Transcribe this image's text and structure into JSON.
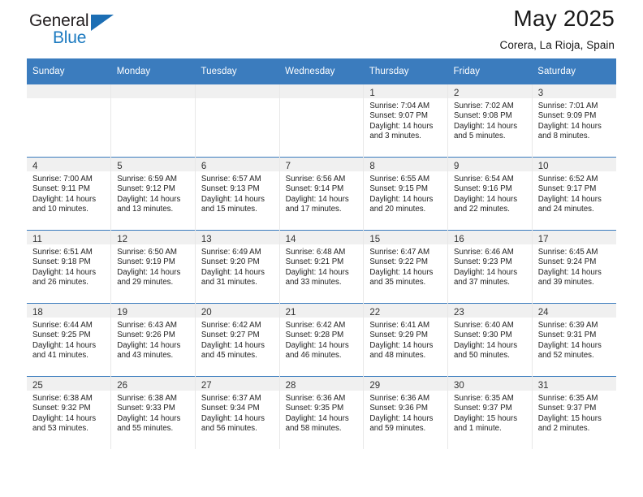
{
  "brand": {
    "name_top": "General",
    "name_bottom": "Blue",
    "accent_color": "#1c6eb4"
  },
  "header": {
    "title": "May 2025",
    "location": "Corera, La Rioja, Spain",
    "header_bg": "#3b7cbe",
    "daynum_band_bg": "#f0f0f0"
  },
  "weekday_headers": [
    "Sunday",
    "Monday",
    "Tuesday",
    "Wednesday",
    "Thursday",
    "Friday",
    "Saturday"
  ],
  "weeks": [
    [
      {
        "day": "",
        "sunrise": "",
        "sunset": "",
        "daylight_line1": "",
        "daylight_line2": ""
      },
      {
        "day": "",
        "sunrise": "",
        "sunset": "",
        "daylight_line1": "",
        "daylight_line2": ""
      },
      {
        "day": "",
        "sunrise": "",
        "sunset": "",
        "daylight_line1": "",
        "daylight_line2": ""
      },
      {
        "day": "",
        "sunrise": "",
        "sunset": "",
        "daylight_line1": "",
        "daylight_line2": ""
      },
      {
        "day": "1",
        "sunrise": "Sunrise: 7:04 AM",
        "sunset": "Sunset: 9:07 PM",
        "daylight_line1": "Daylight: 14 hours",
        "daylight_line2": "and 3 minutes."
      },
      {
        "day": "2",
        "sunrise": "Sunrise: 7:02 AM",
        "sunset": "Sunset: 9:08 PM",
        "daylight_line1": "Daylight: 14 hours",
        "daylight_line2": "and 5 minutes."
      },
      {
        "day": "3",
        "sunrise": "Sunrise: 7:01 AM",
        "sunset": "Sunset: 9:09 PM",
        "daylight_line1": "Daylight: 14 hours",
        "daylight_line2": "and 8 minutes."
      }
    ],
    [
      {
        "day": "4",
        "sunrise": "Sunrise: 7:00 AM",
        "sunset": "Sunset: 9:11 PM",
        "daylight_line1": "Daylight: 14 hours",
        "daylight_line2": "and 10 minutes."
      },
      {
        "day": "5",
        "sunrise": "Sunrise: 6:59 AM",
        "sunset": "Sunset: 9:12 PM",
        "daylight_line1": "Daylight: 14 hours",
        "daylight_line2": "and 13 minutes."
      },
      {
        "day": "6",
        "sunrise": "Sunrise: 6:57 AM",
        "sunset": "Sunset: 9:13 PM",
        "daylight_line1": "Daylight: 14 hours",
        "daylight_line2": "and 15 minutes."
      },
      {
        "day": "7",
        "sunrise": "Sunrise: 6:56 AM",
        "sunset": "Sunset: 9:14 PM",
        "daylight_line1": "Daylight: 14 hours",
        "daylight_line2": "and 17 minutes."
      },
      {
        "day": "8",
        "sunrise": "Sunrise: 6:55 AM",
        "sunset": "Sunset: 9:15 PM",
        "daylight_line1": "Daylight: 14 hours",
        "daylight_line2": "and 20 minutes."
      },
      {
        "day": "9",
        "sunrise": "Sunrise: 6:54 AM",
        "sunset": "Sunset: 9:16 PM",
        "daylight_line1": "Daylight: 14 hours",
        "daylight_line2": "and 22 minutes."
      },
      {
        "day": "10",
        "sunrise": "Sunrise: 6:52 AM",
        "sunset": "Sunset: 9:17 PM",
        "daylight_line1": "Daylight: 14 hours",
        "daylight_line2": "and 24 minutes."
      }
    ],
    [
      {
        "day": "11",
        "sunrise": "Sunrise: 6:51 AM",
        "sunset": "Sunset: 9:18 PM",
        "daylight_line1": "Daylight: 14 hours",
        "daylight_line2": "and 26 minutes."
      },
      {
        "day": "12",
        "sunrise": "Sunrise: 6:50 AM",
        "sunset": "Sunset: 9:19 PM",
        "daylight_line1": "Daylight: 14 hours",
        "daylight_line2": "and 29 minutes."
      },
      {
        "day": "13",
        "sunrise": "Sunrise: 6:49 AM",
        "sunset": "Sunset: 9:20 PM",
        "daylight_line1": "Daylight: 14 hours",
        "daylight_line2": "and 31 minutes."
      },
      {
        "day": "14",
        "sunrise": "Sunrise: 6:48 AM",
        "sunset": "Sunset: 9:21 PM",
        "daylight_line1": "Daylight: 14 hours",
        "daylight_line2": "and 33 minutes."
      },
      {
        "day": "15",
        "sunrise": "Sunrise: 6:47 AM",
        "sunset": "Sunset: 9:22 PM",
        "daylight_line1": "Daylight: 14 hours",
        "daylight_line2": "and 35 minutes."
      },
      {
        "day": "16",
        "sunrise": "Sunrise: 6:46 AM",
        "sunset": "Sunset: 9:23 PM",
        "daylight_line1": "Daylight: 14 hours",
        "daylight_line2": "and 37 minutes."
      },
      {
        "day": "17",
        "sunrise": "Sunrise: 6:45 AM",
        "sunset": "Sunset: 9:24 PM",
        "daylight_line1": "Daylight: 14 hours",
        "daylight_line2": "and 39 minutes."
      }
    ],
    [
      {
        "day": "18",
        "sunrise": "Sunrise: 6:44 AM",
        "sunset": "Sunset: 9:25 PM",
        "daylight_line1": "Daylight: 14 hours",
        "daylight_line2": "and 41 minutes."
      },
      {
        "day": "19",
        "sunrise": "Sunrise: 6:43 AM",
        "sunset": "Sunset: 9:26 PM",
        "daylight_line1": "Daylight: 14 hours",
        "daylight_line2": "and 43 minutes."
      },
      {
        "day": "20",
        "sunrise": "Sunrise: 6:42 AM",
        "sunset": "Sunset: 9:27 PM",
        "daylight_line1": "Daylight: 14 hours",
        "daylight_line2": "and 45 minutes."
      },
      {
        "day": "21",
        "sunrise": "Sunrise: 6:42 AM",
        "sunset": "Sunset: 9:28 PM",
        "daylight_line1": "Daylight: 14 hours",
        "daylight_line2": "and 46 minutes."
      },
      {
        "day": "22",
        "sunrise": "Sunrise: 6:41 AM",
        "sunset": "Sunset: 9:29 PM",
        "daylight_line1": "Daylight: 14 hours",
        "daylight_line2": "and 48 minutes."
      },
      {
        "day": "23",
        "sunrise": "Sunrise: 6:40 AM",
        "sunset": "Sunset: 9:30 PM",
        "daylight_line1": "Daylight: 14 hours",
        "daylight_line2": "and 50 minutes."
      },
      {
        "day": "24",
        "sunrise": "Sunrise: 6:39 AM",
        "sunset": "Sunset: 9:31 PM",
        "daylight_line1": "Daylight: 14 hours",
        "daylight_line2": "and 52 minutes."
      }
    ],
    [
      {
        "day": "25",
        "sunrise": "Sunrise: 6:38 AM",
        "sunset": "Sunset: 9:32 PM",
        "daylight_line1": "Daylight: 14 hours",
        "daylight_line2": "and 53 minutes."
      },
      {
        "day": "26",
        "sunrise": "Sunrise: 6:38 AM",
        "sunset": "Sunset: 9:33 PM",
        "daylight_line1": "Daylight: 14 hours",
        "daylight_line2": "and 55 minutes."
      },
      {
        "day": "27",
        "sunrise": "Sunrise: 6:37 AM",
        "sunset": "Sunset: 9:34 PM",
        "daylight_line1": "Daylight: 14 hours",
        "daylight_line2": "and 56 minutes."
      },
      {
        "day": "28",
        "sunrise": "Sunrise: 6:36 AM",
        "sunset": "Sunset: 9:35 PM",
        "daylight_line1": "Daylight: 14 hours",
        "daylight_line2": "and 58 minutes."
      },
      {
        "day": "29",
        "sunrise": "Sunrise: 6:36 AM",
        "sunset": "Sunset: 9:36 PM",
        "daylight_line1": "Daylight: 14 hours",
        "daylight_line2": "and 59 minutes."
      },
      {
        "day": "30",
        "sunrise": "Sunrise: 6:35 AM",
        "sunset": "Sunset: 9:37 PM",
        "daylight_line1": "Daylight: 15 hours",
        "daylight_line2": "and 1 minute."
      },
      {
        "day": "31",
        "sunrise": "Sunrise: 6:35 AM",
        "sunset": "Sunset: 9:37 PM",
        "daylight_line1": "Daylight: 15 hours",
        "daylight_line2": "and 2 minutes."
      }
    ]
  ]
}
